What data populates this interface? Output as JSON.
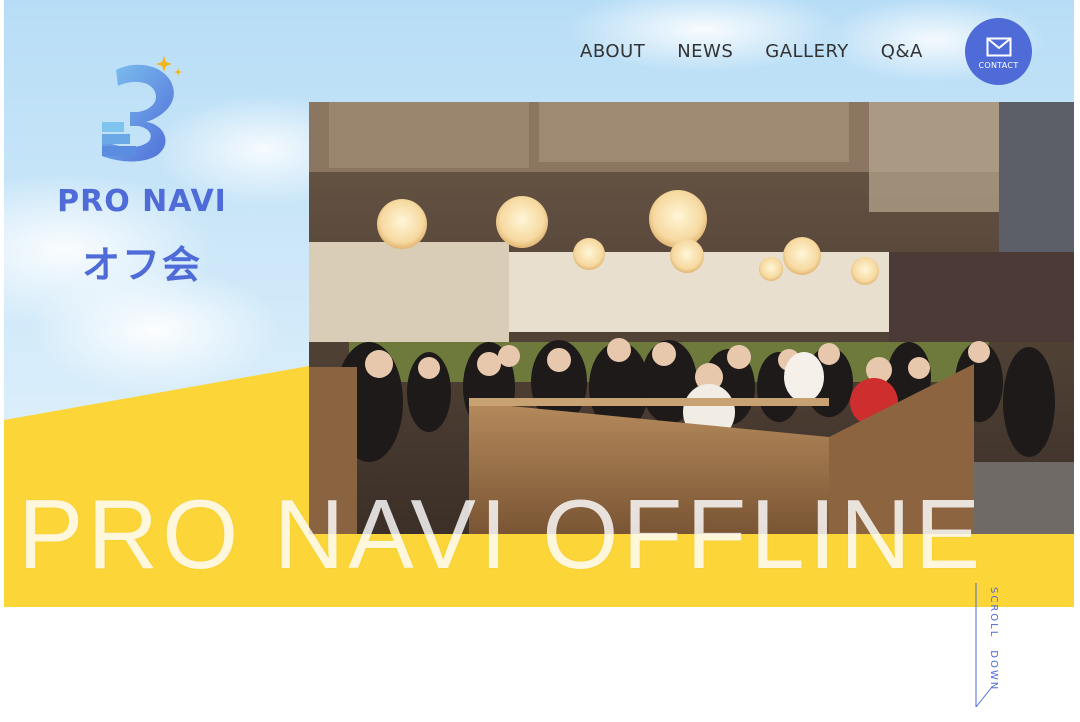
{
  "brand": {
    "name": "PRO NAVI",
    "subtitle": "オフ会"
  },
  "nav": {
    "items": [
      "ABOUT",
      "NEWS",
      "GALLERY",
      "Q&A"
    ]
  },
  "contact": {
    "label": "CONTACT",
    "icon": "mail-icon"
  },
  "hero": {
    "title": "PRO NAVI OFFLINE",
    "photo_alt": "group photo at restaurant"
  },
  "scroll": {
    "label": "SCROLL　DOWN"
  },
  "colors": {
    "brand_blue": "#4e6bd8",
    "accent_yellow": "#fcd638",
    "sky": "#b7ddf6"
  }
}
